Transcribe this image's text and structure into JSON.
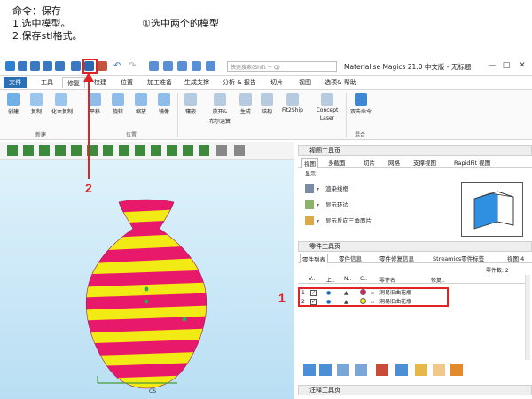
{
  "instructions": {
    "line1": "命令：保存",
    "line2": "1.选中模型。",
    "line3": "2.保存stl格式。",
    "note": "①选中两个的模型"
  },
  "titlebar": {
    "search_placeholder": "快速搜索(Shift + Q)",
    "app_title": "Materialise Magics 21.0 中文版 - 无标题",
    "minimize": "—",
    "maximize": "□",
    "close": "✕"
  },
  "ribbon_tabs": [
    "文件",
    "工具",
    "修复",
    "校建",
    "位置",
    "加工准备",
    "生成支撑",
    "分析 & 报告",
    "切片",
    "视图",
    "选项& 帮助"
  ],
  "ribbon": {
    "buttons": [
      "创建",
      "复制",
      "化血复制",
      "平移",
      "旋转",
      "缩放",
      "镜像",
      "镶嵌",
      "放开&",
      "生成",
      "结构",
      "Fit2Ship",
      "Concept",
      "双击命令"
    ],
    "sub_labels": [
      "布尔运算",
      "Laser"
    ],
    "groups": [
      "新建",
      "位置",
      "混合"
    ]
  },
  "view_toolbar": {
    "title": "视图工具页",
    "tabs": [
      "视图",
      "多截面",
      "切片",
      "网格",
      "支撑视图",
      "RapidFit 视图"
    ],
    "section_label": "显示",
    "options": [
      "渲染线框",
      "显示环边",
      "显示反向三角面片"
    ]
  },
  "parts_toolbar": {
    "title": "零件工具页",
    "tabs": [
      "零件列表",
      "零件信息",
      "零件修复信息",
      "Streamics零件标签",
      "视图 4"
    ],
    "summary": "零件数: 2",
    "columns": [
      "V..",
      "上..",
      "N..",
      "C..",
      "零件名",
      "修复.."
    ],
    "rows": [
      {
        "index": "1",
        "name": "洞易旧曲花瓶",
        "color": "#e8196a"
      },
      {
        "index": "2",
        "name": "洞易旧曲花瓶",
        "color": "#f2ea14"
      }
    ]
  },
  "bottom_panel": {
    "title": "注释工具页"
  },
  "viewport": {
    "cs_label": "CS"
  },
  "annotations": {
    "n1": "1",
    "n2": "2"
  }
}
